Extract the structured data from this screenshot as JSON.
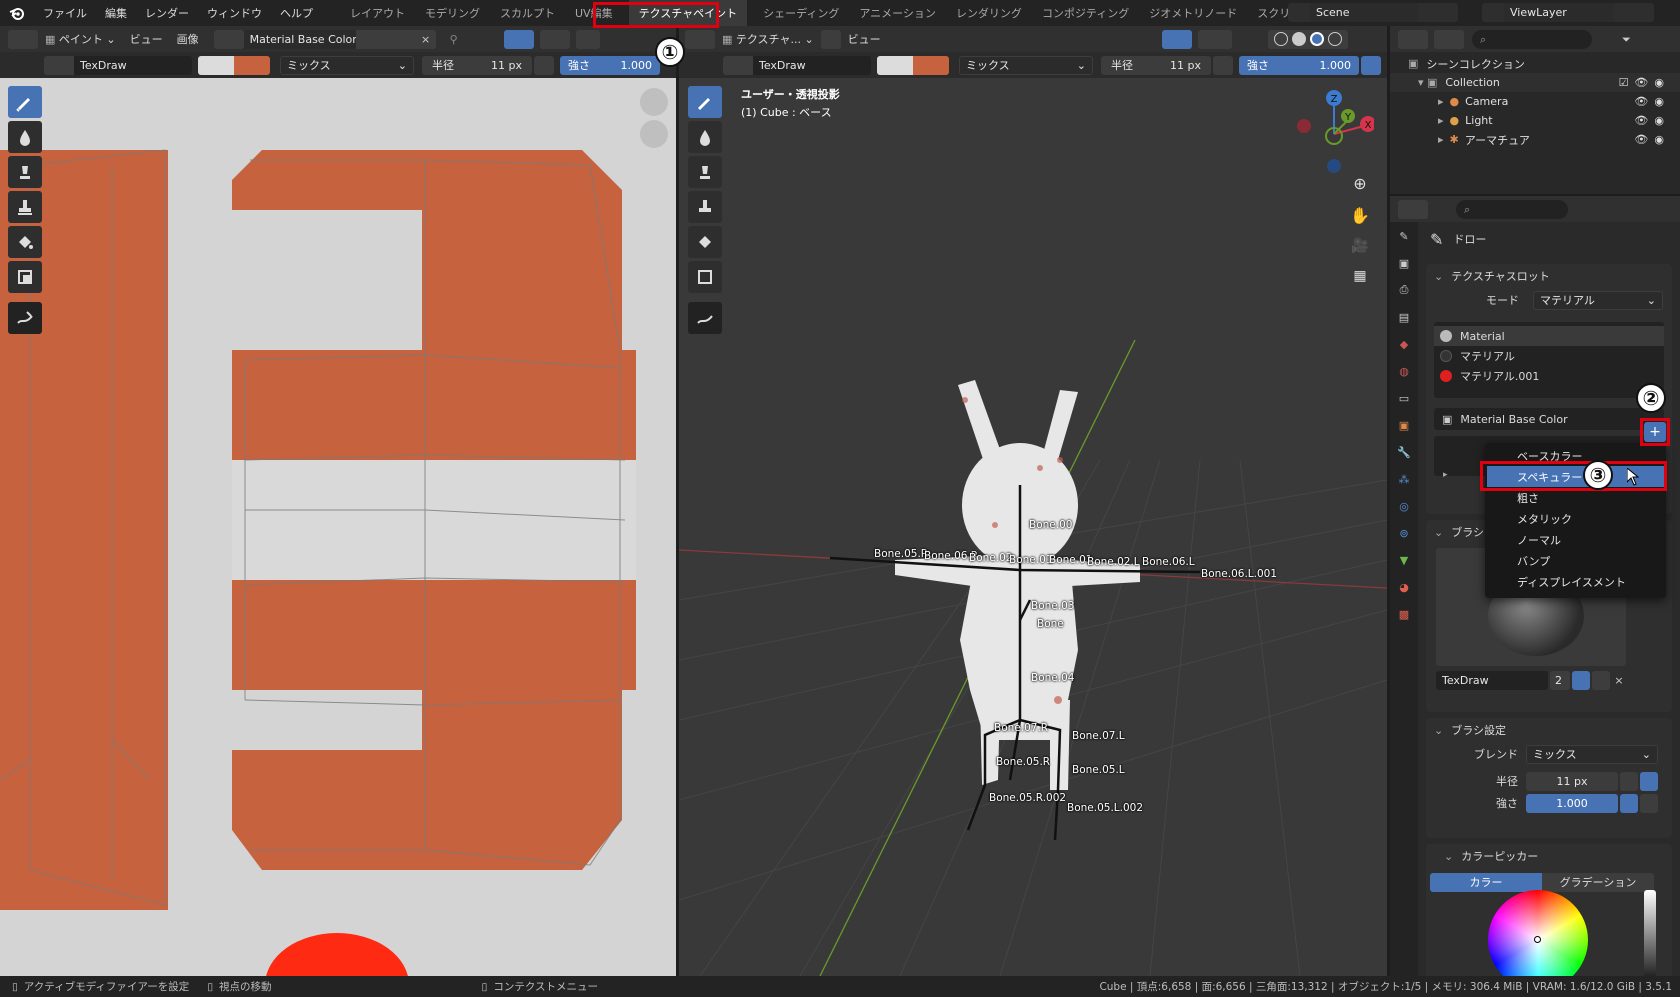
{
  "topbar": {
    "menus": [
      "ファイル",
      "編集",
      "レンダー",
      "ウィンドウ",
      "ヘルプ"
    ],
    "workspaces": [
      "レイアウト",
      "モデリング",
      "スカルプト",
      "UV編集",
      "テクスチャペイント",
      "シェーディング",
      "アニメーション",
      "レンダリング",
      "コンポジティング",
      "ジオメトリノード",
      "スクリプト"
    ],
    "active_workspace": "テクスチャペイント",
    "scene": "Scene",
    "view_layer": "ViewLayer"
  },
  "image_editor": {
    "header": {
      "mode": "ペイント",
      "view": "ビュー",
      "image": "画像",
      "image_name": "Material Base Color"
    },
    "tool_settings": {
      "brush": "TexDraw",
      "blend": "ミックス",
      "radius_label": "半径",
      "radius_value": "11 px",
      "strength_label": "強さ",
      "strength_value": "1.000"
    }
  },
  "viewport": {
    "header": {
      "mode": "テクスチャ...",
      "view": "ビュー"
    },
    "tool_settings": {
      "brush": "TexDraw",
      "blend": "ミックス",
      "radius_label": "半径",
      "radius_value": "11 px",
      "strength_label": "強さ",
      "strength_value": "1.000"
    },
    "info_line1": "ユーザー・透視投影",
    "info_line2": "(1) Cube : ベース",
    "bones": [
      "Bone.00",
      "Bone.05.R",
      "Bone.06.R",
      "Bone.02",
      "Bone.01",
      "Bone.01",
      "Bone.02.L",
      "Bone.06.L",
      "Bone.06.L.001",
      "Bone.03",
      "Bone",
      "Bone.04",
      "Bone.07.R",
      "Bone.07.L",
      "Bone.05.R",
      "Bone.05.L",
      "Bone.05.R.002",
      "Bone.05.L.002"
    ],
    "gizmo": {
      "z": "Z",
      "y": "Y",
      "x": "X"
    }
  },
  "outliner": {
    "scene_collection": "シーンコレクション",
    "items": [
      {
        "label": "Collection",
        "level": 1
      },
      {
        "label": "Camera",
        "level": 2
      },
      {
        "label": "Light",
        "level": 2
      },
      {
        "label": "アーマチュア",
        "level": 2
      }
    ]
  },
  "properties": {
    "tool_name": "ドロー",
    "texture_slots_title": "テクスチャスロット",
    "mode_label": "モード",
    "mode_value": "マテリアル",
    "materials": [
      "Material",
      "マテリアル",
      "マテリアル.001"
    ],
    "slot_name": "Material Base Color",
    "brush_section": "ブラシ",
    "brush_name": "TexDraw",
    "brush_users": "2",
    "brush_settings_title": "ブラシ設定",
    "blend_label": "ブレンド",
    "blend_value": "ミックス",
    "radius_label": "半径",
    "radius_value": "11 px",
    "strength_label": "強さ",
    "strength_value": "1.000",
    "color_picker_title": "カラーピッカー",
    "tab_color": "カラー",
    "tab_gradient": "グラデーション"
  },
  "popup_menu": {
    "items": [
      "ベースカラー",
      "スペキュラー",
      "粗さ",
      "メタリック",
      "ノーマル",
      "バンプ",
      "ディスプレイスメント"
    ],
    "highlighted": "スペキュラー"
  },
  "annotations": [
    "①",
    "②",
    "③"
  ],
  "statusbar": {
    "left1": "アクティブモディファイアーを設定",
    "left2": "視点の移動",
    "left3": "コンテクストメニュー",
    "right": "Cube | 頂点:6,658 | 面:6,656 | 三角面:13,312 | オブジェクト:1/5 | メモリ: 306.4 MiB | VRAM: 1.6/12.0 GiB | 3.5.1"
  },
  "colors": {
    "accent": "#4772b3",
    "paint": "#c6623e",
    "highlight_red": "#e0000f",
    "canvas_bg": "#d4d4d4",
    "viewport_bg": "#393939"
  }
}
